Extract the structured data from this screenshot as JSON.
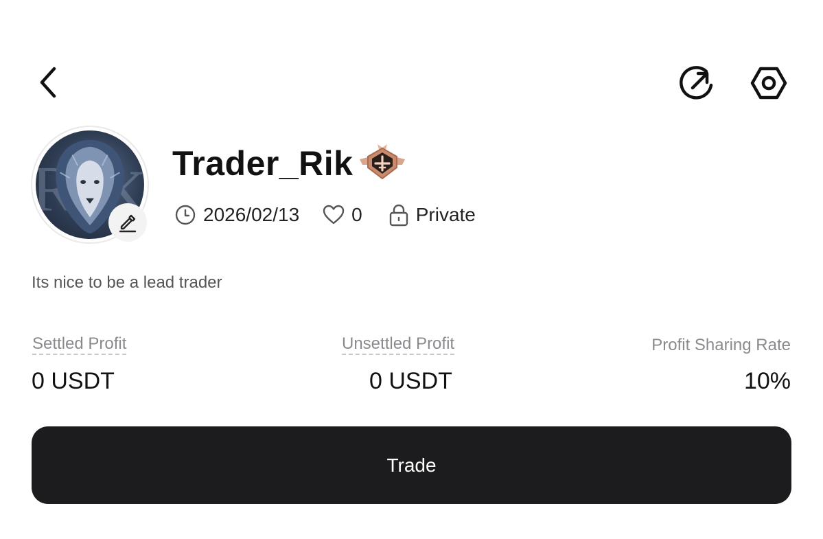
{
  "header": {
    "back_icon": "chevron-left-icon",
    "share_icon": "share-arrow-icon",
    "settings_icon": "hexagon-gear-icon"
  },
  "profile": {
    "username": "Trader_Rik",
    "avatar_icon": "lion-avatar",
    "rank_badge_icon": "rank-wings-badge-icon",
    "edit_icon": "pencil-icon",
    "created_date": "2026/02/13",
    "likes": "0",
    "visibility": "Private",
    "bio": "Its nice to be a lead trader"
  },
  "stats": {
    "settled_profit_label": "Settled Profit",
    "settled_profit_value": "0 USDT",
    "unsettled_profit_label": "Unsettled Profit",
    "unsettled_profit_value": "0 USDT",
    "profit_sharing_label": "Profit Sharing Rate",
    "profit_sharing_value": "10%"
  },
  "actions": {
    "trade_label": "Trade"
  },
  "colors": {
    "primary_button": "#1c1c1e",
    "muted_text": "#8a8a8e",
    "badge_bronze": "#c98a6d"
  }
}
